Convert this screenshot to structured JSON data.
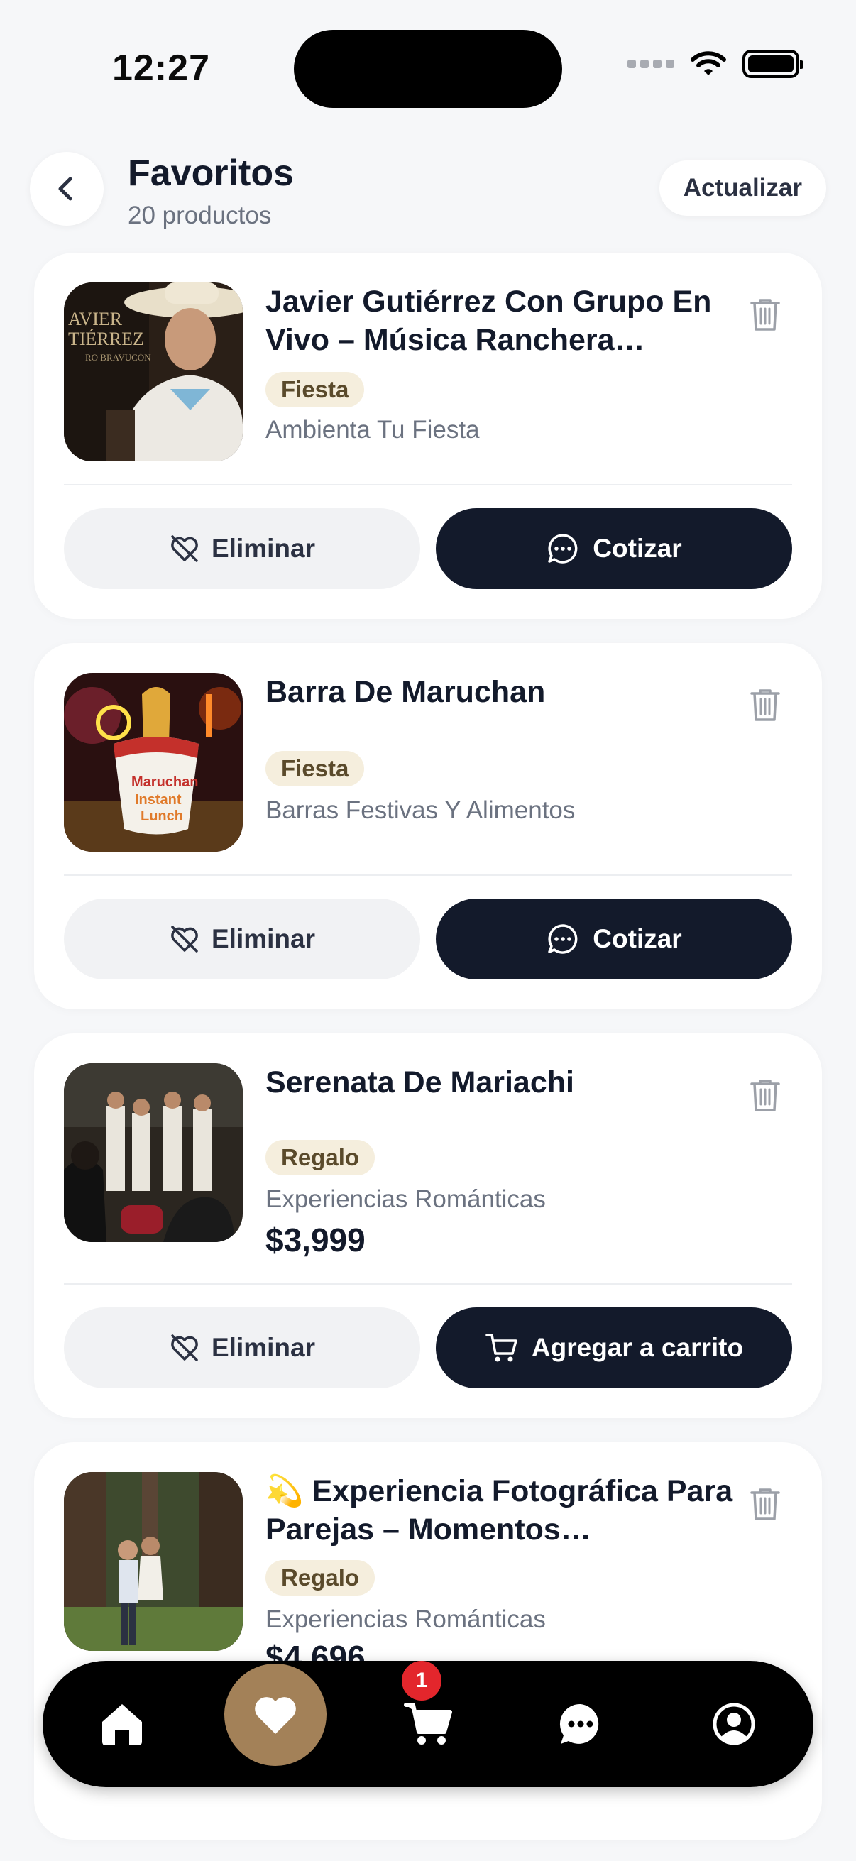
{
  "status_bar": {
    "time": "12:27"
  },
  "header": {
    "title": "Favoritos",
    "subtitle": "20 productos",
    "refresh_label": "Actualizar"
  },
  "favorites": [
    {
      "title": "Javier Gutiérrez Con Grupo En Vivo – Música Ranchera…",
      "tag": "Fiesta",
      "category": "Ambienta Tu Fiesta",
      "remove_label": "Eliminar",
      "action_label": "Cotizar",
      "action_icon": "chat-bubble-icon"
    },
    {
      "title": "Barra De Maruchan",
      "tag": "Fiesta",
      "category": "Barras Festivas Y Alimentos",
      "remove_label": "Eliminar",
      "action_label": "Cotizar",
      "action_icon": "chat-bubble-icon"
    },
    {
      "title": "Serenata De Mariachi",
      "tag": "Regalo",
      "category": "Experiencias Románticas",
      "price": "$3,999",
      "remove_label": "Eliminar",
      "action_label": "Agregar a carrito",
      "action_icon": "cart-icon"
    },
    {
      "title": "💫 Experiencia Fotográfica Para Parejas – Momentos…",
      "tag": "Regalo",
      "category": "Experiencias Románticas",
      "price": "$4,696"
    }
  ],
  "thumbnail_texts": {
    "card1": [
      "AVIER",
      "TIÉRREZ",
      "RO BRAVUCÓN"
    ],
    "card2": [
      "Maruchan",
      "Instant",
      "Lunch"
    ]
  },
  "bottom_nav": {
    "items": [
      "home-icon",
      "heart-icon",
      "cart-icon",
      "chat-icon",
      "profile-icon"
    ],
    "active": "heart-icon",
    "cart_badge": "1"
  },
  "colors": {
    "primary": "#131a2b",
    "accent": "#a38158",
    "tag_bg": "#f5eedd",
    "badge": "#e3262c",
    "background": "#f6f7f9"
  }
}
